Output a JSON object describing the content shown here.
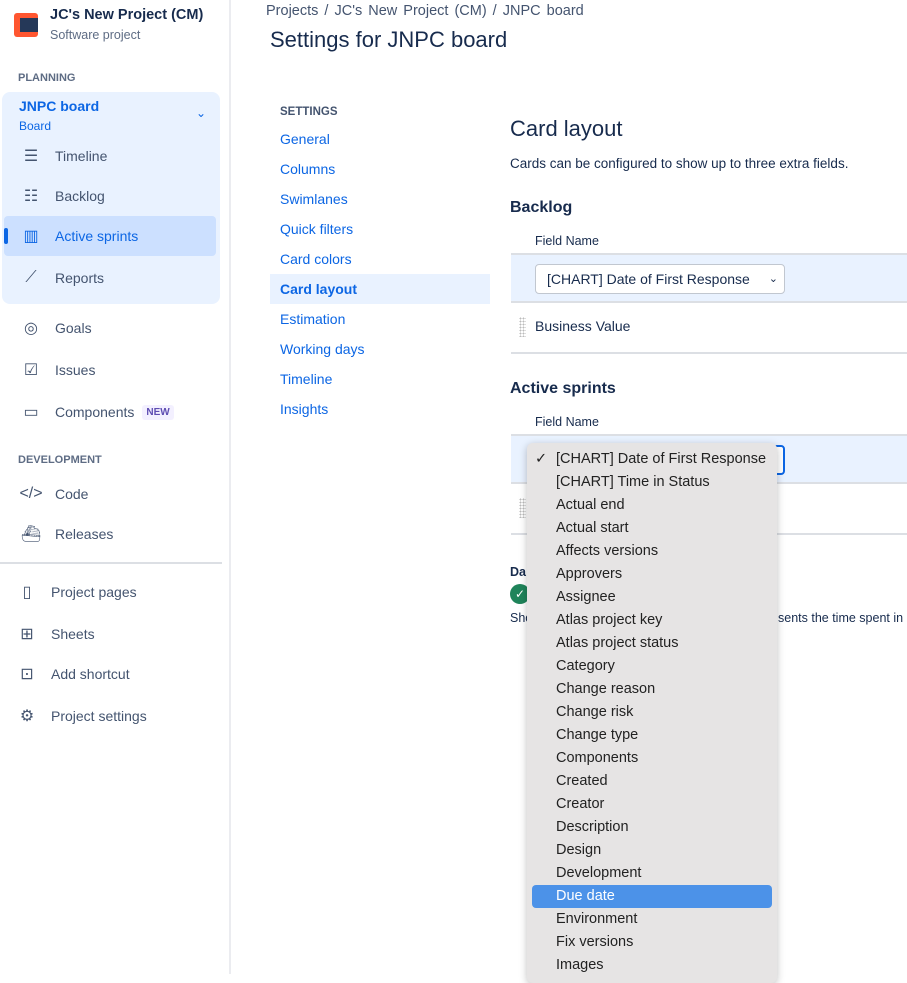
{
  "project": {
    "name": "JC's New Project (CM)",
    "type": "Software project"
  },
  "sidebar": {
    "planning_label": "PLANNING",
    "board": {
      "name": "JNPC board",
      "subtitle": "Board"
    },
    "board_items": [
      {
        "label": "Timeline",
        "icon": "timeline-icon"
      },
      {
        "label": "Backlog",
        "icon": "backlog-icon"
      },
      {
        "label": "Active sprints",
        "icon": "board-icon"
      },
      {
        "label": "Reports",
        "icon": "reports-icon"
      }
    ],
    "items": [
      {
        "label": "Goals"
      },
      {
        "label": "Issues"
      },
      {
        "label": "Components",
        "badge": "NEW"
      }
    ],
    "development_label": "DEVELOPMENT",
    "dev_items": [
      {
        "label": "Code"
      },
      {
        "label": "Releases"
      }
    ],
    "bottom_items": [
      {
        "label": "Project pages"
      },
      {
        "label": "Sheets"
      },
      {
        "label": "Add shortcut"
      },
      {
        "label": "Project settings"
      }
    ]
  },
  "breadcrumb": [
    "Projects",
    "JC's New Project (CM)",
    "JNPC board"
  ],
  "page_title": "Settings for JNPC board",
  "settings_nav": {
    "heading": "SETTINGS",
    "items": [
      "General",
      "Columns",
      "Swimlanes",
      "Quick filters",
      "Card colors",
      "Card layout",
      "Estimation",
      "Working days",
      "Timeline",
      "Insights"
    ],
    "selected": "Card layout"
  },
  "main": {
    "title": "Card layout",
    "description": "Cards can be configured to show up to three extra fields.",
    "backlog": {
      "heading": "Backlog",
      "column": "Field Name",
      "select_value": "[CHART] Date of First Response",
      "rows": [
        "Business Value"
      ]
    },
    "active_sprints": {
      "heading": "Active sprints",
      "column": "Field Name"
    },
    "days_label_partial": "Da",
    "help_partial_left": "Sho",
    "help_partial_right": "sents the time spent in"
  },
  "dropdown": {
    "selected": "[CHART] Date of First Response",
    "highlighted": "Due date",
    "options": [
      "[CHART] Date of First Response",
      "[CHART] Time in Status",
      "Actual end",
      "Actual start",
      "Affects versions",
      "Approvers",
      "Assignee",
      "Atlas project key",
      "Atlas project status",
      "Category",
      "Change reason",
      "Change risk",
      "Change type",
      "Components",
      "Created",
      "Creator",
      "Description",
      "Design",
      "Development",
      "Due date",
      "Environment",
      "Fix versions",
      "Images"
    ]
  }
}
